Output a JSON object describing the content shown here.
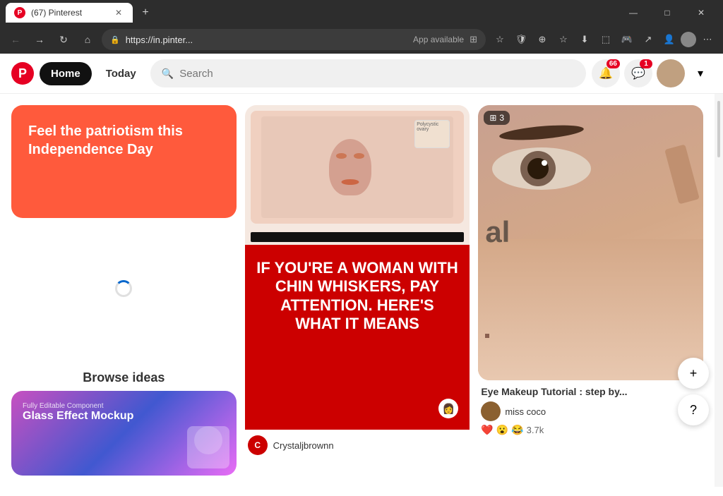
{
  "browser": {
    "tab_count_label": "(67) Pinterest",
    "url": "https://in.pinter...",
    "app_available_label": "App available",
    "window_controls": {
      "minimize": "—",
      "maximize": "□",
      "close": "✕"
    }
  },
  "nav": {
    "home_label": "Home",
    "today_label": "Today",
    "search_placeholder": "Search",
    "notifications_count": "66",
    "messages_count": "1"
  },
  "patriotism_card": {
    "title": "Feel the patriotism this Independence Day"
  },
  "browse_section": {
    "title": "Browse ideas"
  },
  "glass_card": {
    "label": "Fully Editable Component",
    "title": "Glass Effect Mockup"
  },
  "chin_whiskers_card": {
    "main_text": "IF YOU'RE A WOMAN WITH CHIN WHISKERS, PAY ATTENTION. HERE'S WHAT IT MEANS",
    "author_initial": "C",
    "author_name": "Crystaljbrownn"
  },
  "eye_makeup_card": {
    "collection_count": "3",
    "text_overlay": "al",
    "title": "Eye Makeup Tutorial : step by...",
    "author_name": "miss coco",
    "reactions": [
      "❤️",
      "😮",
      "😂"
    ],
    "reaction_count": "3.7k"
  },
  "fab": {
    "plus_label": "+",
    "question_label": "?"
  }
}
